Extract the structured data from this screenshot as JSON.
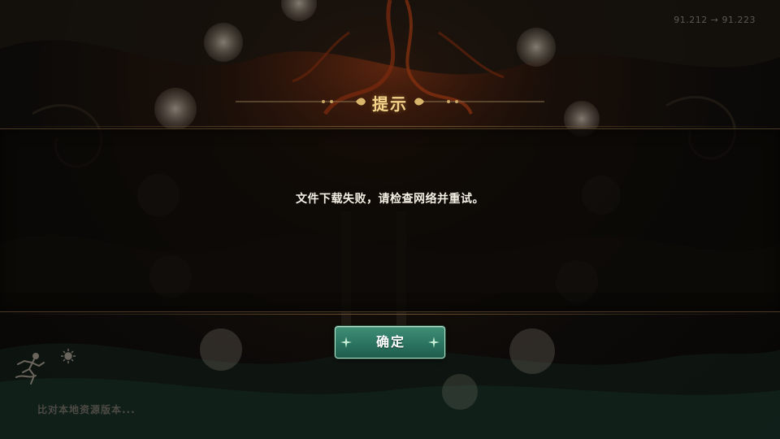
{
  "version_text": "91.212 → 91.223",
  "dialog": {
    "title": "提示",
    "message": "文件下载失败，请检查网络并重试。",
    "confirm_label": "确定"
  },
  "status": {
    "loading_text": "比对本地资源版本..."
  },
  "colors": {
    "title_gold": "#f3d48a",
    "button_teal": "#2b7461",
    "message_white": "#f4efe4"
  },
  "icons": {
    "button_sparkle": "sparkle-icon",
    "loading_runner": "running-figure-icon",
    "sun": "sun-icon"
  }
}
